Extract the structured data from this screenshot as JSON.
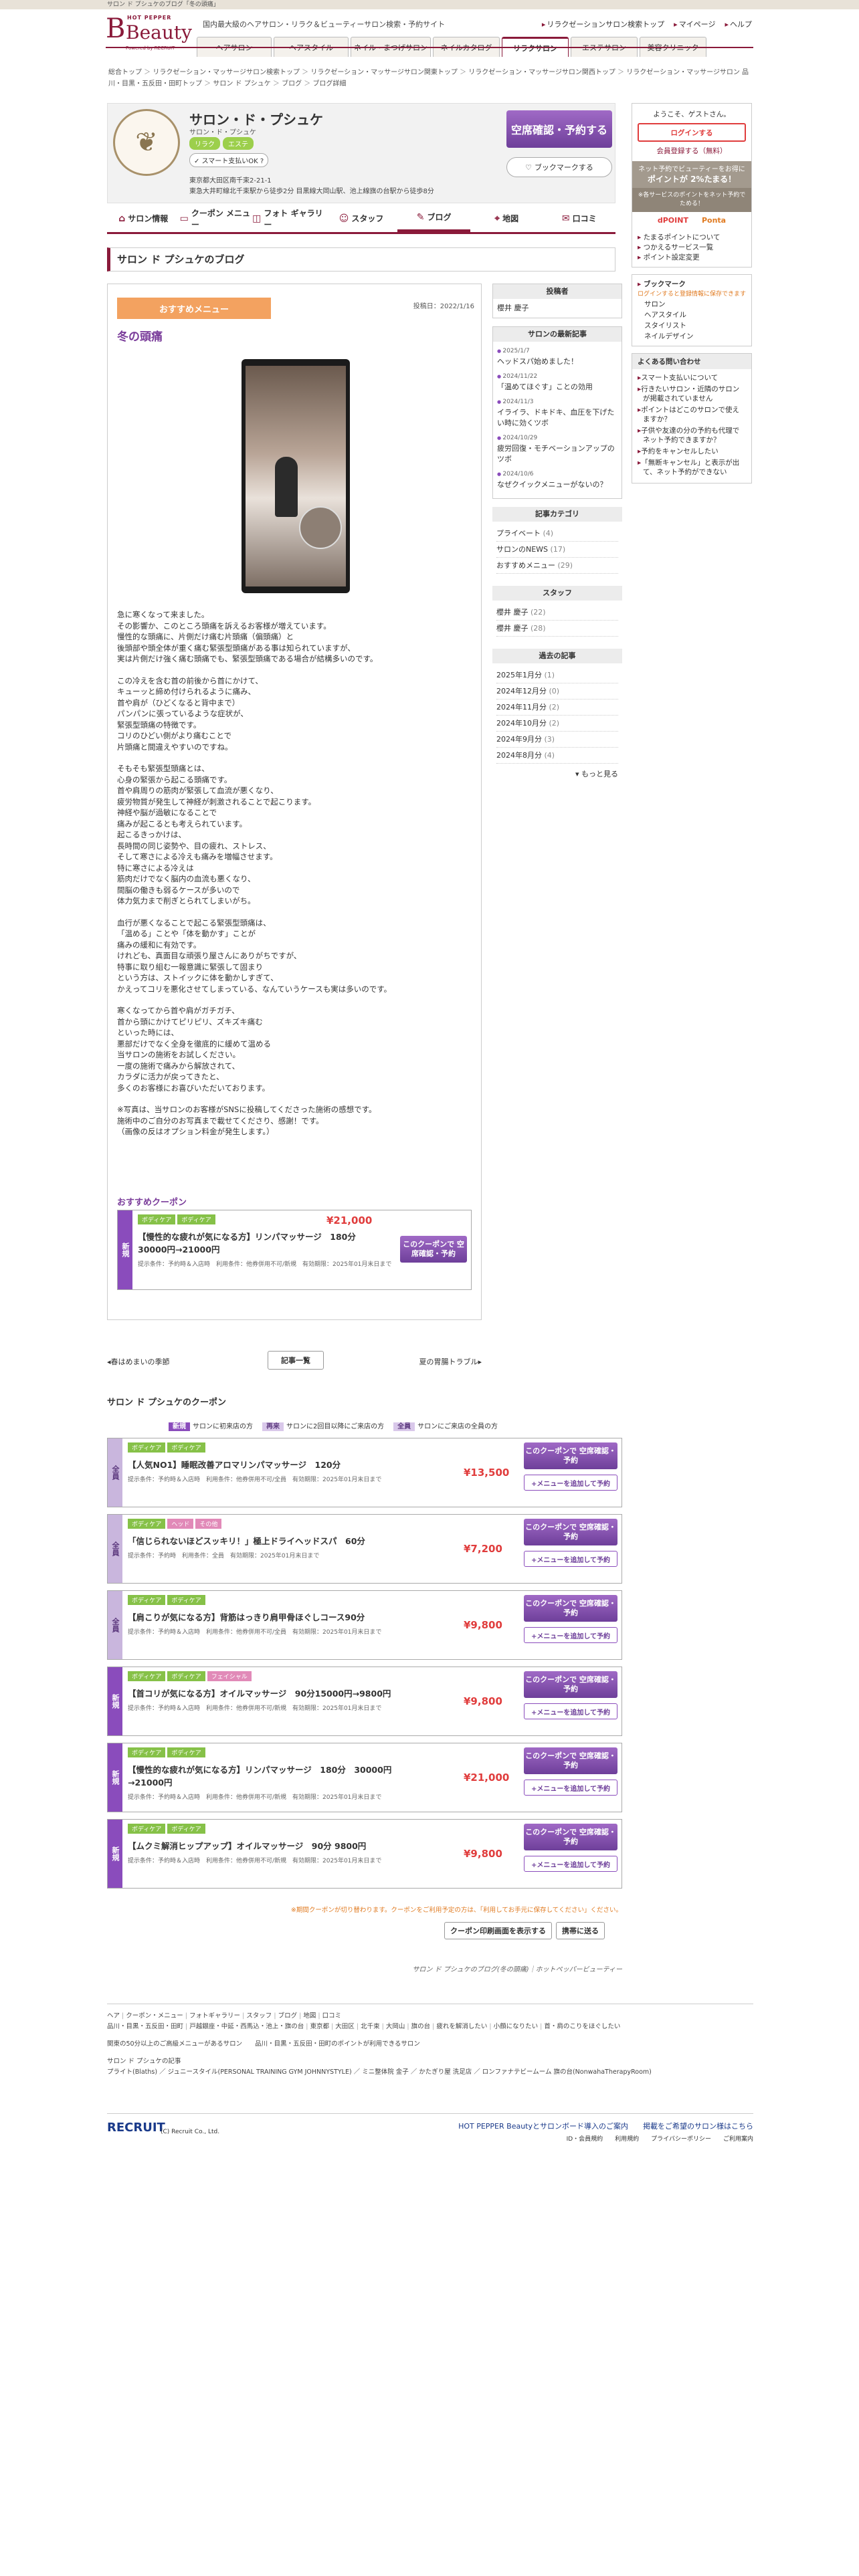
{
  "topbar": {
    "text": "サロン ド プシュケのブログ「冬の頭痛」"
  },
  "header": {
    "hp": "HOT PEPPER",
    "logo": "Beauty",
    "powered": "Powered by RECRUIT",
    "tagline": "国内最大級のヘアサロン・リラク＆ビューティーサロン検索・予約サイト",
    "links": [
      "リラクゼーションサロン検索トップ",
      "マイページ",
      "ヘルプ"
    ],
    "tabs": [
      "ヘアサロン",
      "ヘアスタイル",
      "ネイル・まつげサロン",
      "ネイルカタログ",
      "リラクサロン",
      "エステサロン",
      "美容クリニック"
    ]
  },
  "breadcrumb": [
    "総合トップ",
    "リラクゼーション・マッサージサロン検索トップ",
    "リラクゼーション・マッサージサロン関東トップ",
    "リラクゼーション・マッサージサロン関西トップ",
    "リラクゼーション・マッサージサロン 品川・目黒・五反田・田町トップ",
    "サロン ド プシュケ",
    "ブログ",
    "ブログ詳細"
  ],
  "salon": {
    "logo_icon": "leaf-emblem-icon",
    "name": "サロン・ド・プシュケ",
    "kana": "サロン・ド・プシュケ",
    "badges": [
      "リラク",
      "エステ"
    ],
    "smart": "スマート支払いOK",
    "help": "?",
    "address1": "東京都大田区南千束2-21-1",
    "address2": "東急大井町線北千束駅から徒歩2分 目黒線大岡山駅、池上線旗の台駅から徒歩8分",
    "reserve": "空席確認・予約する",
    "bookmark": "ブックマークする"
  },
  "subnav": [
    {
      "icon": "home-icon",
      "label": "サロン情報"
    },
    {
      "icon": "coupon-icon",
      "label": "クーポン メニュー"
    },
    {
      "icon": "photo-icon",
      "label": "フォト ギャラリー"
    },
    {
      "icon": "staff-icon",
      "label": "スタッフ"
    },
    {
      "icon": "pen-icon",
      "label": "ブログ"
    },
    {
      "icon": "map-pin-icon",
      "label": "地図"
    },
    {
      "icon": "chat-icon",
      "label": "口コミ"
    }
  ],
  "page_title": "サロン ド プシュケのブログ",
  "article": {
    "category": "おすすめメニュー",
    "date": "投稿日：2022/1/16",
    "title": "冬の頭痛",
    "paragraphs": [
      "急に寒くなって来ました。\nその影響か、このところ頭痛を訴えるお客様が増えています。\n慢性的な頭痛に、片側だけ痛む片頭痛（偏頭痛）と\n後頭部や頭全体が重く痛む緊張型頭痛がある事は知られていますが、\n実は片側だけ強く痛む頭痛でも、緊張型頭痛である場合が結構多いのです。",
      "この冷えを含む首の前後から首にかけて、\nキューッと締め付けられるように痛み、\n首や肩が（ひどくなると背中まで）\nパンパンに張っているような症状が、\n緊張型頭痛の特徴です。\nコリのひどい側がより痛むことで\n片頭痛と間違えやすいのですね。",
      "そもそも緊張型頭痛とは、\n心身の緊張から起こる頭痛です。\n首や肩周りの筋肉が緊張して血流が悪くなり、\n疲労物質が発生して神経が刺激されることで起こります。\n神経や脳が過敏になることで\n痛みが起こるとも考えられています。\n起こるきっかけは、\n長時間の同じ姿勢や、目の疲れ、ストレス、\nそして寒さによる冷えも痛みを増幅させます。\n特に寒さによる冷えは\n筋肉だけでなく脳内の血流も悪くなり、\n間脳の働きも弱るケースが多いので\n体力気力まで削ぎとられてしまいがち。",
      "血行が悪くなることで起こる緊張型頭痛は、\n「温める」ことや「体を動かす」ことが\n痛みの緩和に有効です。\nけれども、真面目な頑張り屋さんにありがちですが、\n特事に取り組む一報意識に緊張して固まり\nという方は、ストイックに体を動かしすぎて、\nかえってコリを悪化させてしまっている、なんていうケースも実は多いのです。",
      "寒くなってから首や肩がガチガチ、\n首から頭にかけてピリピリ、ズキズキ痛む\nといった時には、\n悪部だけでなく全身を徹底的に緩めて温める\n当サロンの施術をお試しください。\n一度の施術で痛みから解放されて、\nカラダに活力が戻ってきたと、\n多くのお客様にお喜びいただいております。",
      "※写真は、当サロンのお客様がSNSに投稿してくださった施術の感想です。\n施術中のご自分のお写真まで載せてくださり、感謝！です。\n（画像の反はオプション料金が発生します。）"
    ],
    "rec_coupon_title": "おすすめクーポン",
    "rec_coupon": {
      "side": "新規",
      "tags": [
        "ボディケア",
        "ボディケア"
      ],
      "price": "¥21,000",
      "name": "【慢性的な疲れが気になる方】リンパマッサージ　180分　30000円→21000円",
      "cond": "提示条件：予約時＆入店時　利用条件：他券併用不可/新規　有効期限：2025年01月末日まで",
      "btn": "このクーポンで 空席確認・予約"
    }
  },
  "pager": {
    "prev": "◂春はめまいの季節",
    "list": "記事一覧",
    "next": "夏の胃腸トラブル▸"
  },
  "right": {
    "poster_head": "投稿者",
    "poster": "櫻井 慶子",
    "recent_head": "サロンの最新記事",
    "recent": [
      {
        "date": "2025/1/7",
        "title": "ヘッドスパ始めました！"
      },
      {
        "date": "2024/11/22",
        "title": "「温めてほぐす」ことの効用"
      },
      {
        "date": "2024/11/3",
        "title": "イライラ、ドキドキ、血圧を下げたい時に効くツボ"
      },
      {
        "date": "2024/10/29",
        "title": "疲労回復・モチベーションアップのツボ"
      },
      {
        "date": "2024/10/6",
        "title": "なぜクイックメニューがないの？"
      }
    ],
    "cat_head": "記事カテゴリ",
    "cats": [
      {
        "n": "プライベート",
        "c": "(4)"
      },
      {
        "n": "サロンのNEWS",
        "c": "(17)"
      },
      {
        "n": "おすすめメニュー",
        "c": "(29)"
      }
    ],
    "staff_head": "スタッフ",
    "staff": [
      {
        "n": "櫻井 慶子",
        "c": "(22)"
      },
      {
        "n": "櫻井 慶子",
        "c": "(28)"
      }
    ],
    "past_head": "過去の記事",
    "past": [
      {
        "n": "2025年1月分",
        "c": "(1)"
      },
      {
        "n": "2024年12月分",
        "c": "(0)"
      },
      {
        "n": "2024年11月分",
        "c": "(2)"
      },
      {
        "n": "2024年10月分",
        "c": "(2)"
      },
      {
        "n": "2024年9月分",
        "c": "(3)"
      },
      {
        "n": "2024年8月分",
        "c": "(4)"
      }
    ],
    "more": "▾ もっと見る"
  },
  "side": {
    "welcome": "ようこそ、ゲストさん。",
    "login": "ログインする",
    "register": "会員登録する（無料）",
    "banner1": "ネット予約でビューティーをお得に",
    "banner1b": "ポイントが 2%たまる！",
    "banner2": "※各サービスのポイントをネット予約でためる！",
    "pontas": [
      "dPOINT",
      "Ponta"
    ],
    "links": [
      "たまるポイントについて",
      "つかえるサービス一覧",
      "ポイント設定変更"
    ],
    "bm_head": "ブックマーク",
    "bm_note": "ログインすると登録情報に保存できます",
    "bm_items": [
      "サロン",
      "ヘアスタイル",
      "スタイリスト",
      "ネイルデザイン"
    ],
    "faq_head": "よくある問い合わせ",
    "faq": [
      "スマート支払いについて",
      "行きたいサロン・近隣のサロンが掲載されていません",
      "ポイントはどこのサロンで使えますか？",
      "子供や友達の分の予約も代理でネット予約できますか？",
      "予約をキャンセルしたい",
      "「無断キャンセル」と表示が出て、ネット予約ができない"
    ]
  },
  "coupons": {
    "title": "サロン ド プシュケのクーポン",
    "legend": [
      {
        "b": "新規",
        "t": "サロンに初来店の方"
      },
      {
        "b": "再来",
        "t": "サロンに2回目以降にご来店の方"
      },
      {
        "b": "全員",
        "t": "サロンにご来店の全員の方"
      }
    ],
    "items": [
      {
        "side": "全員",
        "tags": [
          "ボディケア",
          "ボディケア"
        ],
        "name": "【人気NO1】睡眠改善アロマリンパマッサージ　120分",
        "price": "¥13,500",
        "cond": "提示条件：予約時＆入店時　利用条件：他券併用不可/全員　有効期限：2025年01月末日まで"
      },
      {
        "side": "全員",
        "tags": [
          "ボディケア",
          "ヘッド",
          "その他"
        ],
        "name": "「信じられないほどスッキリ！」極上ドライヘッドスパ　60分",
        "price": "¥7,200",
        "cond": "提示条件：予約時　利用条件：全員　有効期限：2025年01月末日まで"
      },
      {
        "side": "全員",
        "tags": [
          "ボディケア",
          "ボディケア"
        ],
        "name": "【肩こりが気になる方】背筋はっきり肩甲骨ほぐしコース90分",
        "price": "¥9,800",
        "cond": "提示条件：予約時＆入店時　利用条件：他券併用不可/全員　有効期限：2025年01月末日まで"
      },
      {
        "side": "新規",
        "tags": [
          "ボディケア",
          "ボディケア",
          "フェイシャル"
        ],
        "name": "【首コリが気になる方】オイルマッサージ　90分15000円→9800円",
        "price": "¥9,800",
        "cond": "提示条件：予約時＆入店時　利用条件：他券併用不可/新規　有効期限：2025年01月末日まで"
      },
      {
        "side": "新規",
        "tags": [
          "ボディケア",
          "ボディケア"
        ],
        "name": "【慢性的な疲れが気になる方】リンパマッサージ　180分　30000円→21000円",
        "price": "¥21,000",
        "cond": "提示条件：予約時＆入店時　利用条件：他券併用不可/新規　有効期限：2025年01月末日まで"
      },
      {
        "side": "新規",
        "tags": [
          "ボディケア",
          "ボディケア"
        ],
        "name": "【ムクミ解消ヒップアップ】オイルマッサージ　90分 9800円",
        "price": "¥9,800",
        "cond": "提示条件：予約時＆入店時　利用条件：他券併用不可/新規　有効期限：2025年01月末日まで"
      }
    ],
    "btn1": "このクーポンで 空席確認・予約",
    "btn2": "+メニューを追加して予約"
  },
  "notice": "※期間クーポンが切り替わります。クーポンをご利用予定の方は、「利用してお手元に保存してください」ください。",
  "bottom": {
    "print": "クーポン印刷画面を表示する",
    "mobile": "携帯に送る"
  },
  "footline": "サロン ド プシュケのブログ(冬の頭痛)｜ホットペッパービューティー",
  "footer": {
    "row1": [
      "ヘア",
      "クーポン・メニュー",
      "フォトギャラリー",
      "スタッフ",
      "ブログ",
      "地図",
      "口コミ"
    ],
    "row2": [
      "品川・目黒・五反田・田町",
      "戸越銀座・中延・西馬込・池上・旗の台",
      "東京都",
      "大田区",
      "北千束",
      "大岡山",
      "旗の台",
      "疲れを解消したい",
      "小顔になりたい",
      "首・肩のこりをほぐしたい"
    ],
    "row3": "関東の50分以上のご高級メニューがあるサロン　　品川・目黒・五反田・田町のポイントが利用できるサロン",
    "row4": "サロン ド プシュケの記事",
    "row5": "プライト(Blaths) ／ ジュニースタイル(PERSONAL TRAINING GYM JOHNNYSTYLE) ／ ミニ整体院 金子 ／ かたぎり屋 洗足店 ／ ロンファナテビームーム 旗の台(NonwahaTherapyRoom)"
  },
  "recruit": {
    "logo": "RECRUIT",
    "copy": "(C) Recruit Co., Ltd.",
    "links": "HOT PEPPER Beautyとサロンボード導入のご案内　　掲載をご希望のサロン様はこちら",
    "links2": "ID・会員規約　　利用規約　　プライバシーポリシー　　ご利用案内"
  }
}
